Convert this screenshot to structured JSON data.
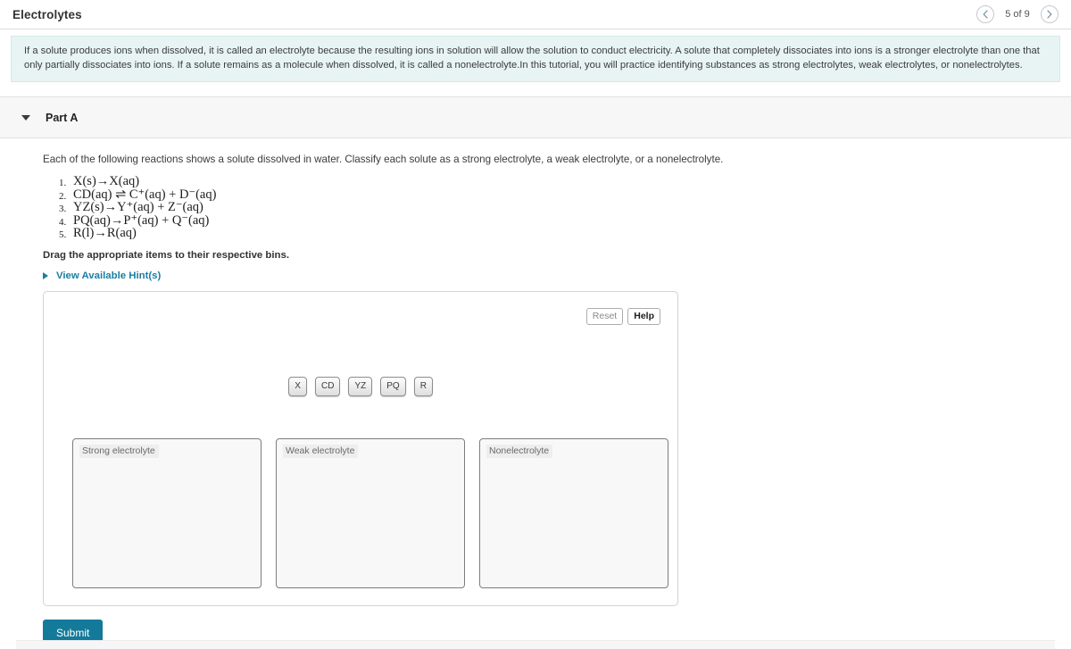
{
  "header": {
    "title": "Electrolytes",
    "pager": {
      "prev_icon": "chevron-left-icon",
      "next_icon": "chevron-right-icon",
      "label": "5 of 9"
    }
  },
  "intro": {
    "text": "If a solute produces ions when dissolved, it is called an electrolyte because the resulting ions in solution will allow the solution to conduct electricity. A solute that completely dissociates into ions is a stronger electrolyte than one that only partially dissociates into ions. If a solute remains as a molecule when dissolved, it is called a nonelectrolyte.In this tutorial, you will practice identifying substances as strong electrolytes, weak electrolytes, or nonelectrolytes."
  },
  "part": {
    "title": "Part A",
    "collapse_icon": "caret-down-icon",
    "prompt": "Each of the following reactions shows a solute dissolved in water. Classify each solute as a strong electrolyte, a weak electrolyte, or a nonelectrolyte.",
    "equations": [
      "X(s)→X(aq)",
      "CD(aq) ⇌ C⁺(aq) + D⁻(aq)",
      "YZ(s)→Y⁺(aq) + Z⁻(aq)",
      "PQ(aq)→P⁺(aq) + Q⁻(aq)",
      "R(l)→R(aq)"
    ],
    "drag_instruction": "Drag the appropriate items to their respective bins.",
    "hint_label": "View Available Hint(s)",
    "hint_icon": "caret-right-icon"
  },
  "dnd": {
    "reset_label": "Reset",
    "help_label": "Help",
    "tokens": [
      "X",
      "CD",
      "YZ",
      "PQ",
      "R"
    ],
    "bins": [
      {
        "label": "Strong electrolyte"
      },
      {
        "label": "Weak electrolyte"
      },
      {
        "label": "Nonelectrolyte"
      }
    ]
  },
  "submit": {
    "label": "Submit"
  },
  "colors": {
    "accent": "#137a9a",
    "link": "#1a7ea3",
    "intro_bg": "#e8f4f4",
    "part_header_bg": "#f7f7f7"
  }
}
